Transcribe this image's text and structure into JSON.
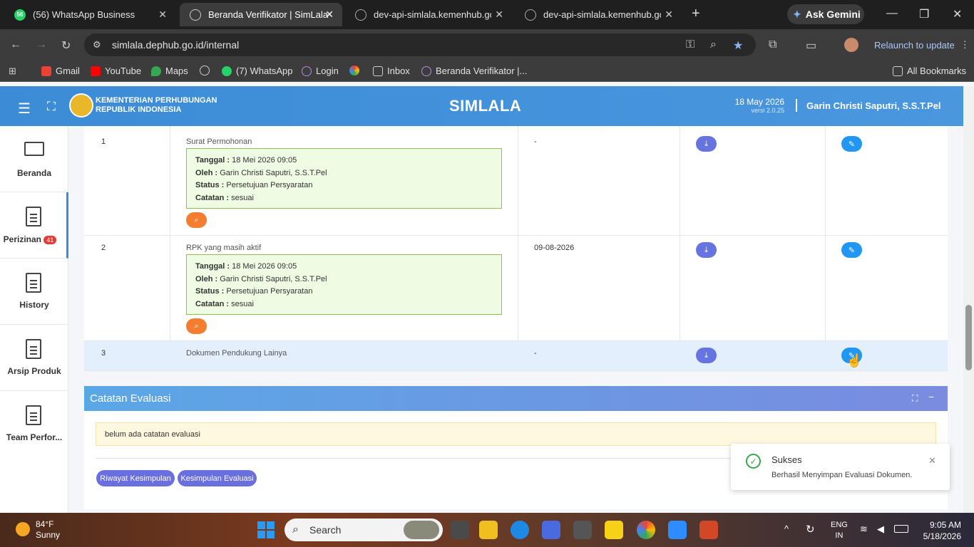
{
  "browser": {
    "tabs": [
      {
        "label": "(56) WhatsApp Business",
        "badge": "56"
      },
      {
        "label": "Beranda Verifikator | SimLala"
      },
      {
        "label": "dev-api-simlala.kemenhub.go.id"
      },
      {
        "label": "dev-api-simlala.kemenhub.go.id"
      }
    ],
    "gemini_label": "Ask Gemini",
    "url": "simlala.dephub.go.id/internal",
    "relaunch_label": "Relaunch to update",
    "bookmarks": [
      "Gmail",
      "YouTube",
      "Maps",
      "(7) WhatsApp",
      "Login",
      "Inbox",
      "Beranda Verifikator |..."
    ],
    "all_bookmarks": "All Bookmarks"
  },
  "header": {
    "org_line1": "KEMENTERIAN PERHUBUNGAN",
    "org_line2": "REPUBLIK INDONESIA",
    "app_title": "SIMLALA",
    "date": "18 May 2026",
    "version": "versi 2.0.25",
    "user": "Garin Christi Saputri, S.S.T.Pel"
  },
  "sidebar": {
    "items": [
      {
        "label": "Beranda"
      },
      {
        "label": "Perizinan",
        "badge": "41"
      },
      {
        "label": "History"
      },
      {
        "label": "Arsip Produk"
      },
      {
        "label": "Team Perfor..."
      }
    ]
  },
  "documents": {
    "rows": [
      {
        "no": "1",
        "name": "Surat Permohonan",
        "date": "-",
        "info": {
          "tanggal": "18 Mei 2026 09:05",
          "oleh": "Garin Christi Saputri, S.S.T.Pel",
          "status": "Persetujuan Persyaratan",
          "catatan": "sesuai"
        }
      },
      {
        "no": "2",
        "name": "RPK yang masih aktif",
        "date": "09-08-2026",
        "info": {
          "tanggal": "18 Mei 2026 09:05",
          "oleh": "Garin Christi Saputri, S.S.T.Pel",
          "status": "Persetujuan Persyaratan",
          "catatan": "sesuai"
        }
      },
      {
        "no": "3",
        "name": "Dokumen Pendukung Lainya",
        "date": "-"
      }
    ],
    "labels": {
      "tanggal": "Tanggal :",
      "oleh": "Oleh :",
      "status": "Status :",
      "catatan": "Catatan :"
    }
  },
  "evaluation": {
    "title": "Catatan Evaluasi",
    "note": "belum ada catatan evaluasi",
    "btn_riwayat": "Riwayat Kesimpulan",
    "btn_kesimpulan": "Kesimpulan Evaluasi"
  },
  "toast": {
    "title": "Sukses",
    "message": "Berhasil Menyimpan Evaluasi Dokumen."
  },
  "taskbar": {
    "weather_temp": "84°F",
    "weather_desc": "Sunny",
    "search_placeholder": "Search",
    "lang1": "ENG",
    "lang2": "IN",
    "time": "9:05 AM",
    "date": "5/18/2026"
  },
  "colors": {
    "header": "#4a97de",
    "download_btn": "#6674e0",
    "edit_btn": "#2196f3",
    "zoom_btn": "#f47d30",
    "success": "#3aa64a"
  }
}
